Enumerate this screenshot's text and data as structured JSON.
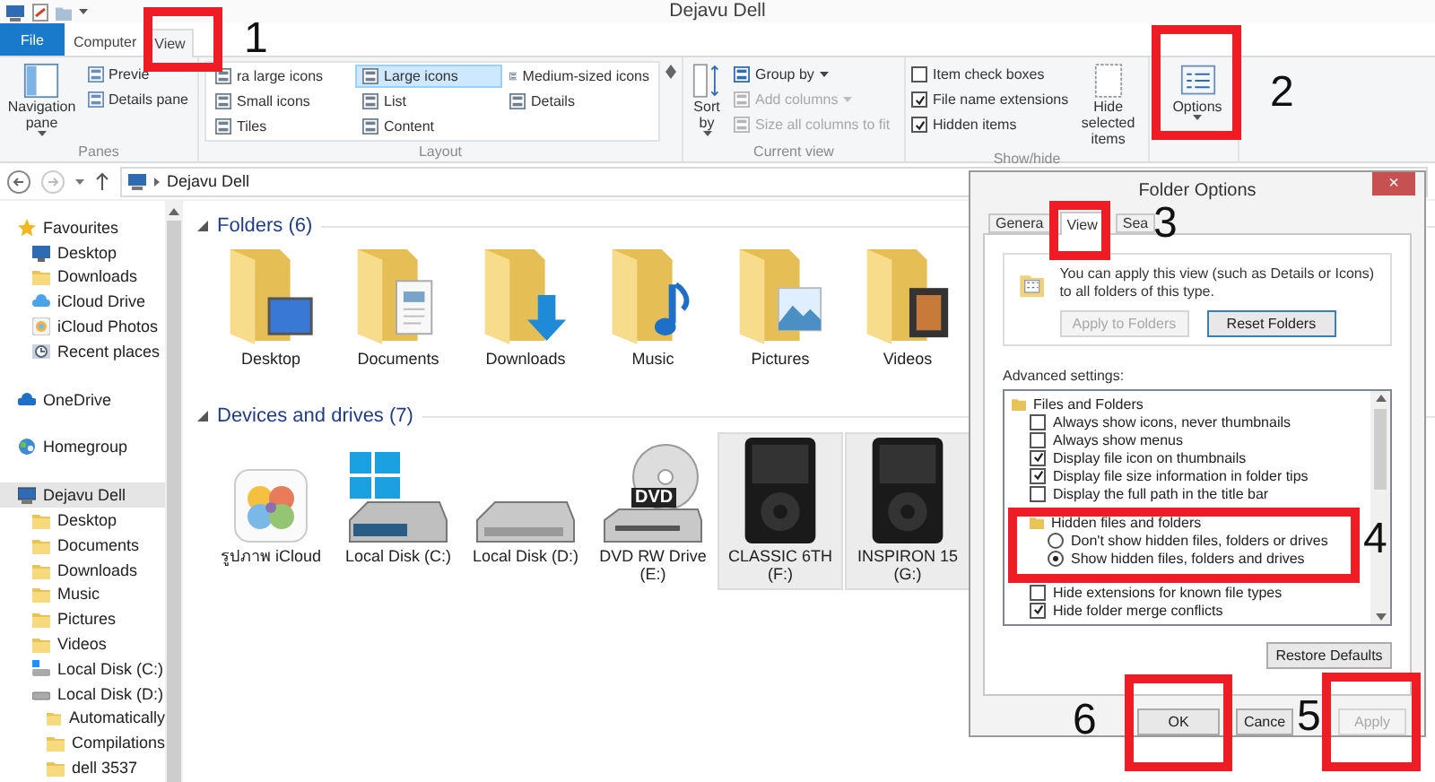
{
  "window": {
    "title": "Dejavu Dell"
  },
  "ribbon_tabs": [
    {
      "label": "File",
      "kind": "file",
      "selected": false
    },
    {
      "label": "Computer",
      "kind": "tab",
      "selected": false
    },
    {
      "label": "View",
      "kind": "tab",
      "selected": true
    }
  ],
  "ribbon": {
    "panes": {
      "label": "Panes",
      "large": "Navigation pane",
      "items": [
        "Previe",
        "Details pane"
      ]
    },
    "layout": {
      "label": "Layout",
      "options": [
        {
          "label": "ra large icons",
          "selected": false
        },
        {
          "label": "Large icons",
          "selected": true
        },
        {
          "label": "Medium-sized icons",
          "selected": false
        },
        {
          "label": "Small icons",
          "selected": false
        },
        {
          "label": "List",
          "selected": false
        },
        {
          "label": "Details",
          "selected": false
        },
        {
          "label": "Tiles",
          "selected": false
        },
        {
          "label": "Content",
          "selected": false
        }
      ]
    },
    "current_view": {
      "label": "Current view",
      "large": "Sort by",
      "items": [
        {
          "label": "Group by",
          "disabled": false,
          "dropdown": true
        },
        {
          "label": "Add columns",
          "disabled": true,
          "dropdown": true
        },
        {
          "label": "Size all columns to fit",
          "disabled": true,
          "dropdown": false
        }
      ]
    },
    "show_hide": {
      "label": "Show/hide",
      "checks": [
        {
          "label": "Item check boxes",
          "checked": false
        },
        {
          "label": "File name extensions",
          "checked": true
        },
        {
          "label": "Hidden items",
          "checked": true
        }
      ],
      "large": "Hide selected items"
    },
    "options": {
      "label": "Options"
    }
  },
  "address": {
    "path": "Dejavu Dell"
  },
  "nav_tree": [
    {
      "label": "Favourites",
      "kind": "star",
      "selected": false,
      "children": [
        {
          "label": "Desktop",
          "kind": "desktop",
          "selected": false
        },
        {
          "label": "Downloads",
          "kind": "folder",
          "selected": false
        },
        {
          "label": "iCloud Drive",
          "kind": "cloud",
          "selected": false
        },
        {
          "label": "iCloud Photos",
          "kind": "photos",
          "selected": false
        },
        {
          "label": "Recent places",
          "kind": "recent",
          "selected": false
        }
      ]
    },
    {
      "label": "OneDrive",
      "kind": "onedrive",
      "selected": false
    },
    {
      "label": "Homegroup",
      "kind": "homegroup",
      "selected": false
    },
    {
      "label": "Dejavu Dell",
      "kind": "computer",
      "selected": true,
      "children": [
        {
          "label": "Desktop",
          "kind": "folder",
          "selected": false
        },
        {
          "label": "Documents",
          "kind": "folder",
          "selected": false
        },
        {
          "label": "Downloads",
          "kind": "folder",
          "selected": false
        },
        {
          "label": "Music",
          "kind": "folder",
          "selected": false
        },
        {
          "label": "Pictures",
          "kind": "folder",
          "selected": false
        },
        {
          "label": "Videos",
          "kind": "folder",
          "selected": false
        },
        {
          "label": "Local Disk (C:)",
          "kind": "windows-drive",
          "selected": false
        },
        {
          "label": "Local Disk (D:)",
          "kind": "drive",
          "selected": false,
          "children": [
            {
              "label": "Automatically",
              "kind": "folder",
              "selected": false
            },
            {
              "label": "Compilations",
              "kind": "folder",
              "selected": false
            },
            {
              "label": "dell 3537",
              "kind": "folder",
              "selected": false
            }
          ]
        }
      ]
    }
  ],
  "sections": [
    {
      "title": "Folders (6)",
      "expanded": true,
      "items": [
        {
          "label": "Desktop",
          "kind": "desktop",
          "selected": false
        },
        {
          "label": "Documents",
          "kind": "documents",
          "selected": false
        },
        {
          "label": "Downloads",
          "kind": "downloads",
          "selected": false
        },
        {
          "label": "Music",
          "kind": "music",
          "selected": false
        },
        {
          "label": "Pictures",
          "kind": "pictures",
          "selected": false
        },
        {
          "label": "Videos",
          "kind": "videos",
          "selected": false
        }
      ]
    },
    {
      "title": "Devices and drives (7)",
      "expanded": true,
      "items": [
        {
          "label": "รูปภาพ iCloud",
          "kind": "photos",
          "selected": false
        },
        {
          "label": "Local Disk (C:)",
          "kind": "windows-drive",
          "selected": false
        },
        {
          "label": "Local Disk (D:)",
          "kind": "drive",
          "selected": false
        },
        {
          "label": "DVD RW Drive (E:)",
          "kind": "dvd-drive",
          "badge": "DVD",
          "selected": false
        },
        {
          "label": "CLASSIC 6TH (F:)",
          "kind": "player",
          "selected": true
        },
        {
          "label": "INSPIRON 15 (G:)",
          "kind": "player",
          "selected": true
        }
      ]
    }
  ],
  "dialog": {
    "title": "Folder Options",
    "close": "×",
    "tabs": [
      {
        "label": "Genera",
        "selected": false
      },
      {
        "label": "View",
        "selected": true
      },
      {
        "label": "Sea",
        "selected": false
      }
    ],
    "folder_views": {
      "text": "You can apply this view (such as Details or Icons) to all folders of this type.",
      "buttons": [
        {
          "label": "Apply to Folders",
          "disabled": true
        },
        {
          "label": "Reset Folders",
          "disabled": false
        }
      ]
    },
    "advanced_label": "Advanced settings:",
    "settings": [
      {
        "kind": "folder",
        "label": "Files and Folders",
        "children": [
          {
            "kind": "checkbox",
            "label": "Always show icons, never thumbnails",
            "checked": false
          },
          {
            "kind": "checkbox",
            "label": "Always show menus",
            "checked": false
          },
          {
            "kind": "checkbox",
            "label": "Display file icon on thumbnails",
            "checked": true
          },
          {
            "kind": "checkbox",
            "label": "Display file size information in folder tips",
            "checked": true
          },
          {
            "kind": "checkbox",
            "label": "Display the full path in the title bar",
            "checked": false
          },
          {
            "kind": "folder",
            "label": "Hidden files and folders",
            "children": [
              {
                "kind": "radio",
                "label": "Don't show hidden files, folders or drives",
                "selected": false
              },
              {
                "kind": "radio",
                "label": "Show hidden files, folders and drives",
                "selected": true
              }
            ]
          },
          {
            "kind": "checkbox",
            "label": "Hide extensions for known file types",
            "checked": false
          },
          {
            "kind": "checkbox",
            "label": "Hide folder merge conflicts",
            "checked": true
          }
        ]
      }
    ],
    "restore": "Restore Defaults",
    "buttons": [
      {
        "label": "OK",
        "disabled": false
      },
      {
        "label": "Cance",
        "disabled": false
      },
      {
        "label": "Apply",
        "disabled": true
      }
    ]
  },
  "annotations": [
    {
      "label": "1"
    },
    {
      "label": "2"
    },
    {
      "label": "3"
    },
    {
      "label": "4"
    },
    {
      "label": "5"
    },
    {
      "label": "6"
    }
  ]
}
